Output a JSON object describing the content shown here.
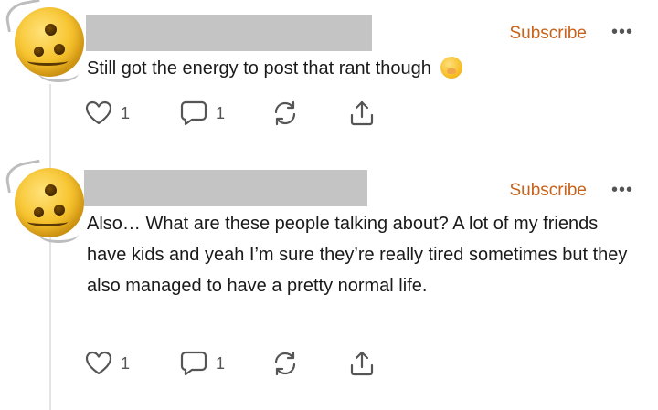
{
  "comments": [
    {
      "subscribe_label": "Subscribe",
      "more_label": "•••",
      "text": "Still got the energy to post that rant though",
      "like_count": "1",
      "reply_count": "1",
      "emoji": "hand-over-mouth-emoji"
    },
    {
      "subscribe_label": "Subscribe",
      "more_label": "•••",
      "text": "Also… What are these people talking about? A lot of my friends have kids and yeah I’m sure they’re really tired sometimes but they also managed to have a pretty normal life.",
      "like_count": "1",
      "reply_count": "1"
    }
  ],
  "icons": {
    "like": "heart-icon",
    "reply": "comment-bubble-icon",
    "restack": "restack-icon",
    "share": "share-icon"
  },
  "colors": {
    "accent": "#c8621a",
    "redacted_name": "#c4c4c4"
  }
}
